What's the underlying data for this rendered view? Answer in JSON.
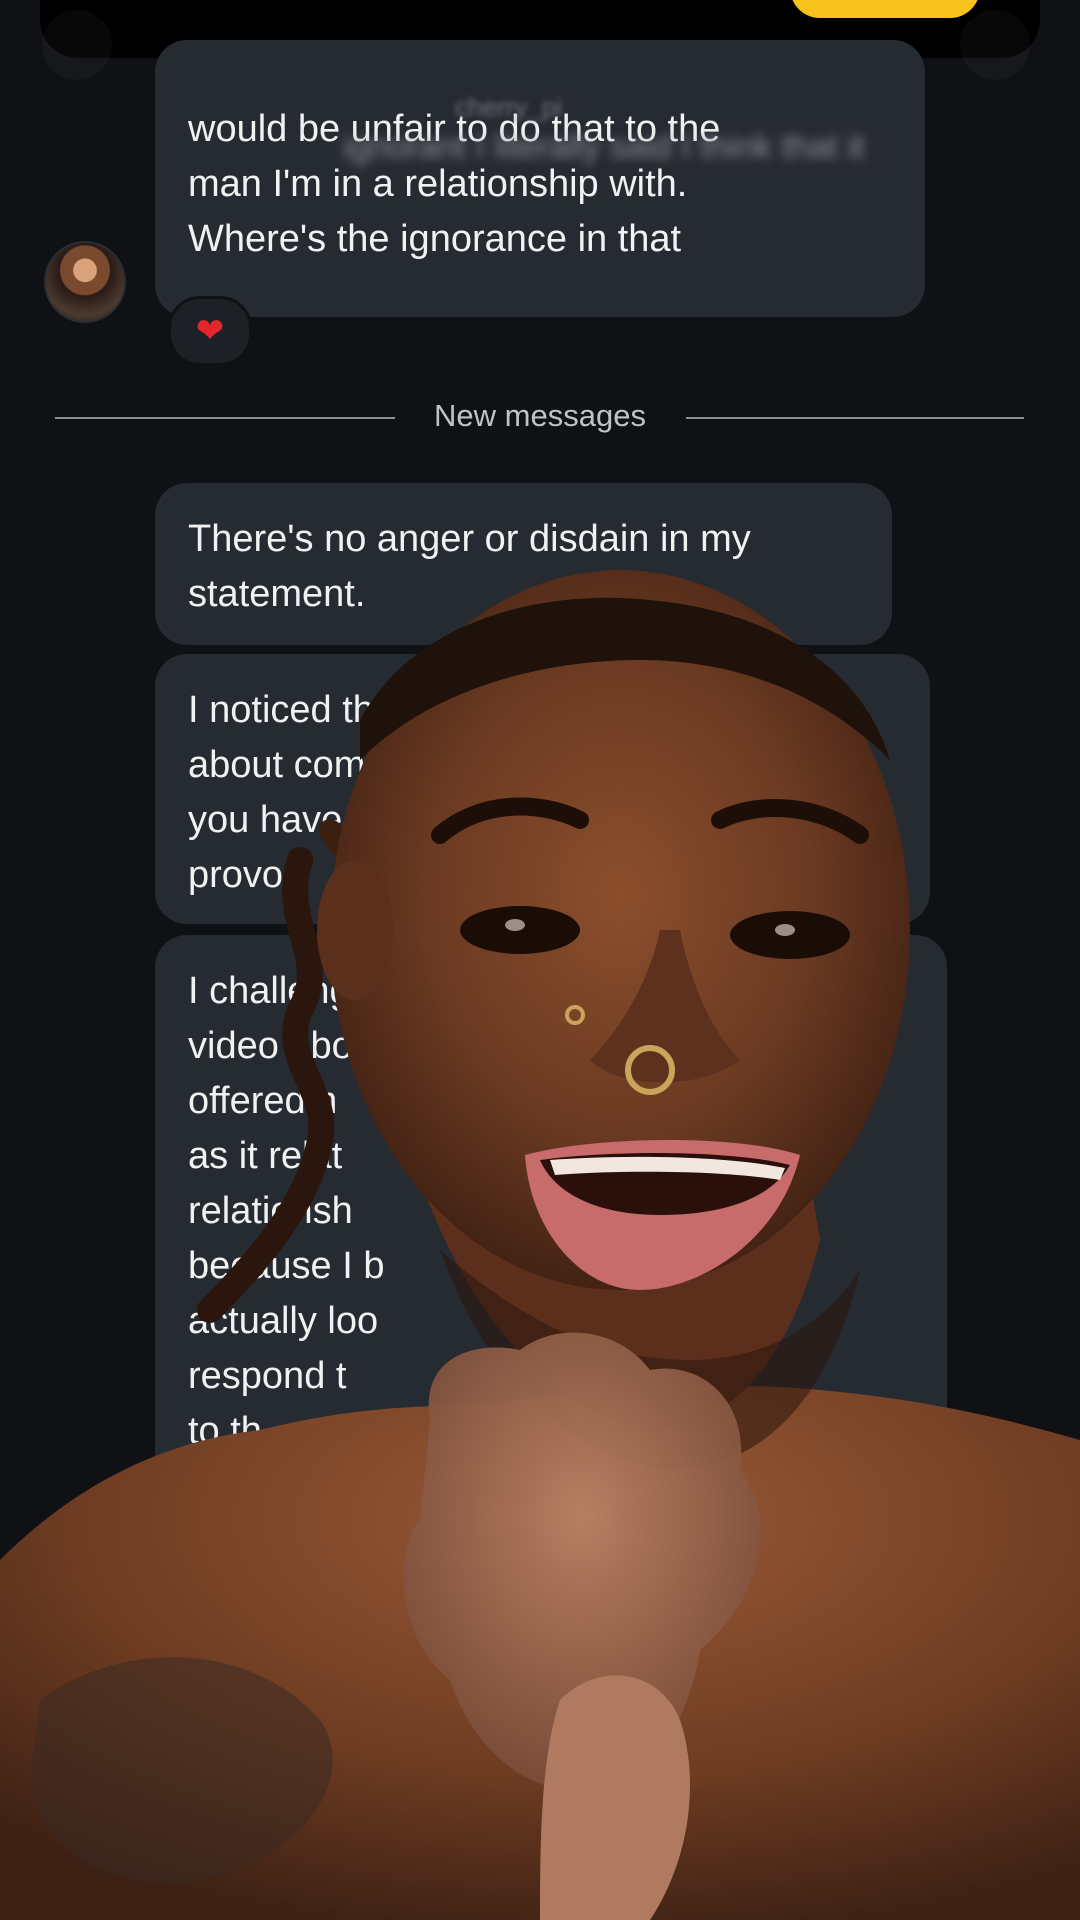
{
  "conversation": {
    "header_sender_blurred": "cherry_pi",
    "messages_before": [
      {
        "blurred_line": "ignorant I literally said I think that it",
        "lines": [
          "would be unfair to do that to the",
          "man I'm in a relationship with.",
          "Where's the ignorance in that"
        ],
        "reaction": "❤"
      }
    ],
    "divider_label": "New messages",
    "messages_after": [
      {
        "lines": [
          "There's no anger or disdain in my",
          "statement."
        ]
      },
      {
        "lines": [
          "I noticed that",
          "about comm",
          "you have",
          "provo"
        ]
      },
      {
        "lines": [
          "I challeng",
          "video abo",
          "offered h",
          "as it relat",
          "relationsh",
          "because I b",
          "actually loo",
          "respond t",
          "to th"
        ]
      }
    ]
  },
  "overlay": {
    "subject": "person-video-overlay",
    "colors": {
      "skin": "#6b3a22",
      "skin_dark": "#3a1d10",
      "lip": "#c76b6b",
      "teeth": "#f2e7e0",
      "gold": "#caa45a"
    }
  }
}
